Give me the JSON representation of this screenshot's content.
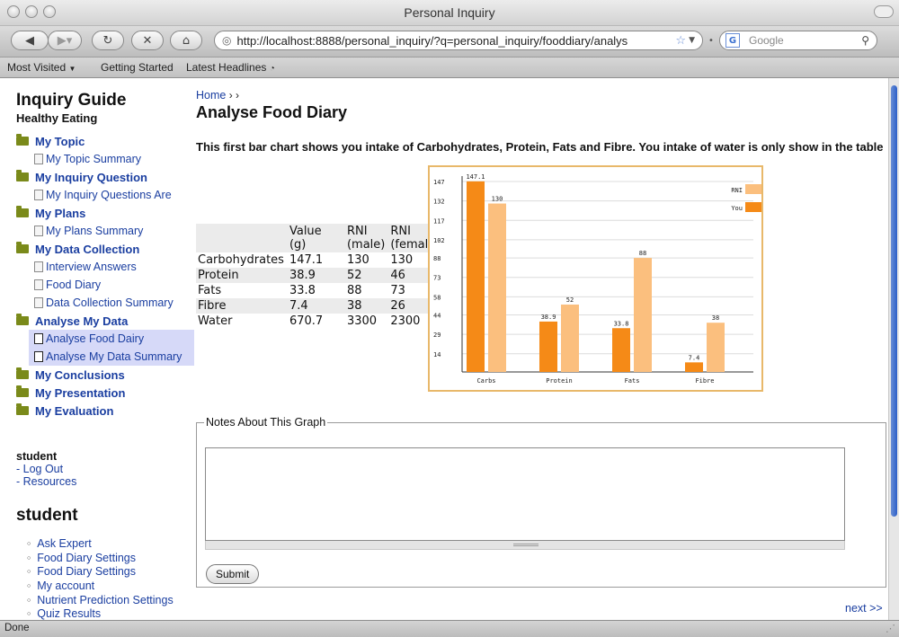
{
  "window": {
    "title": "Personal Inquiry"
  },
  "toolbar": {
    "url": "http://localhost:8888/personal_inquiry/?q=personal_inquiry/fooddiary/analys",
    "search_placeholder": "Google"
  },
  "bookmarks": [
    "Most Visited",
    "Getting Started",
    "Latest Headlines"
  ],
  "sidebar": {
    "title": "Inquiry Guide",
    "subtitle": "Healthy Eating",
    "sections": [
      {
        "label": "My Topic",
        "items": [
          "My Topic Summary"
        ]
      },
      {
        "label": "My Inquiry Question",
        "items": [
          "My Inquiry Questions Are"
        ]
      },
      {
        "label": "My Plans",
        "items": [
          "My Plans Summary"
        ]
      },
      {
        "label": "My Data Collection",
        "items": [
          "Interview Answers",
          "Food Diary",
          "Data Collection Summary"
        ]
      },
      {
        "label": "Analyse My Data",
        "items": [
          "Analyse Food Dairy",
          "Analyse My Data Summary"
        ]
      },
      {
        "label": "My Conclusions",
        "items": []
      },
      {
        "label": "My Presentation",
        "items": []
      },
      {
        "label": "My Evaluation",
        "items": []
      }
    ]
  },
  "user": {
    "name": "student",
    "links": [
      "- Log Out",
      "- Resources"
    ],
    "heading": "student",
    "menu": [
      "Ask Expert",
      "Food Diary Settings",
      "Food Diary Settings",
      "My account",
      "Nutrient Prediction Settings",
      "Quiz Results"
    ]
  },
  "main": {
    "breadcrumb_home": "Home",
    "breadcrumb_sep": "› ›",
    "title": "Analyse Food Diary",
    "intro": "This first bar chart shows you intake of Carbohydrates, Protein, Fats and Fibre. You intake of water is only show in the table",
    "table": {
      "headers": [
        "",
        "Value (g)",
        "RNI (male)",
        "RNI (female)"
      ],
      "rows": [
        [
          "Carbohydrates",
          "147.1",
          "130",
          "130"
        ],
        [
          "Protein",
          "38.9",
          "52",
          "46"
        ],
        [
          "Fats",
          "33.8",
          "88",
          "73"
        ],
        [
          "Fibre",
          "7.4",
          "38",
          "26"
        ],
        [
          "Water",
          "670.7",
          "3300",
          "2300"
        ]
      ]
    },
    "notes_legend": "Notes About This Graph",
    "notes_value": "",
    "submit_label": "Submit",
    "next_label": "next >>"
  },
  "status": {
    "text": "Done"
  },
  "colors": {
    "you": "#f58a17",
    "rni": "#fbbf7e",
    "link": "#1a3ea0",
    "chart_border": "#e8b86a"
  },
  "chart_data": {
    "type": "bar",
    "categories": [
      "Carbs",
      "Protein",
      "Fats",
      "Fibre"
    ],
    "series": [
      {
        "name": "You",
        "values": [
          147.1,
          38.9,
          33.8,
          7.4
        ]
      },
      {
        "name": "RNI",
        "values": [
          130,
          52,
          88,
          38
        ]
      }
    ],
    "yticks": [
      14,
      29,
      44,
      58,
      73,
      88,
      102,
      117,
      132,
      147
    ],
    "ylim": [
      0,
      147
    ],
    "legend": "top-right",
    "grid": true
  }
}
